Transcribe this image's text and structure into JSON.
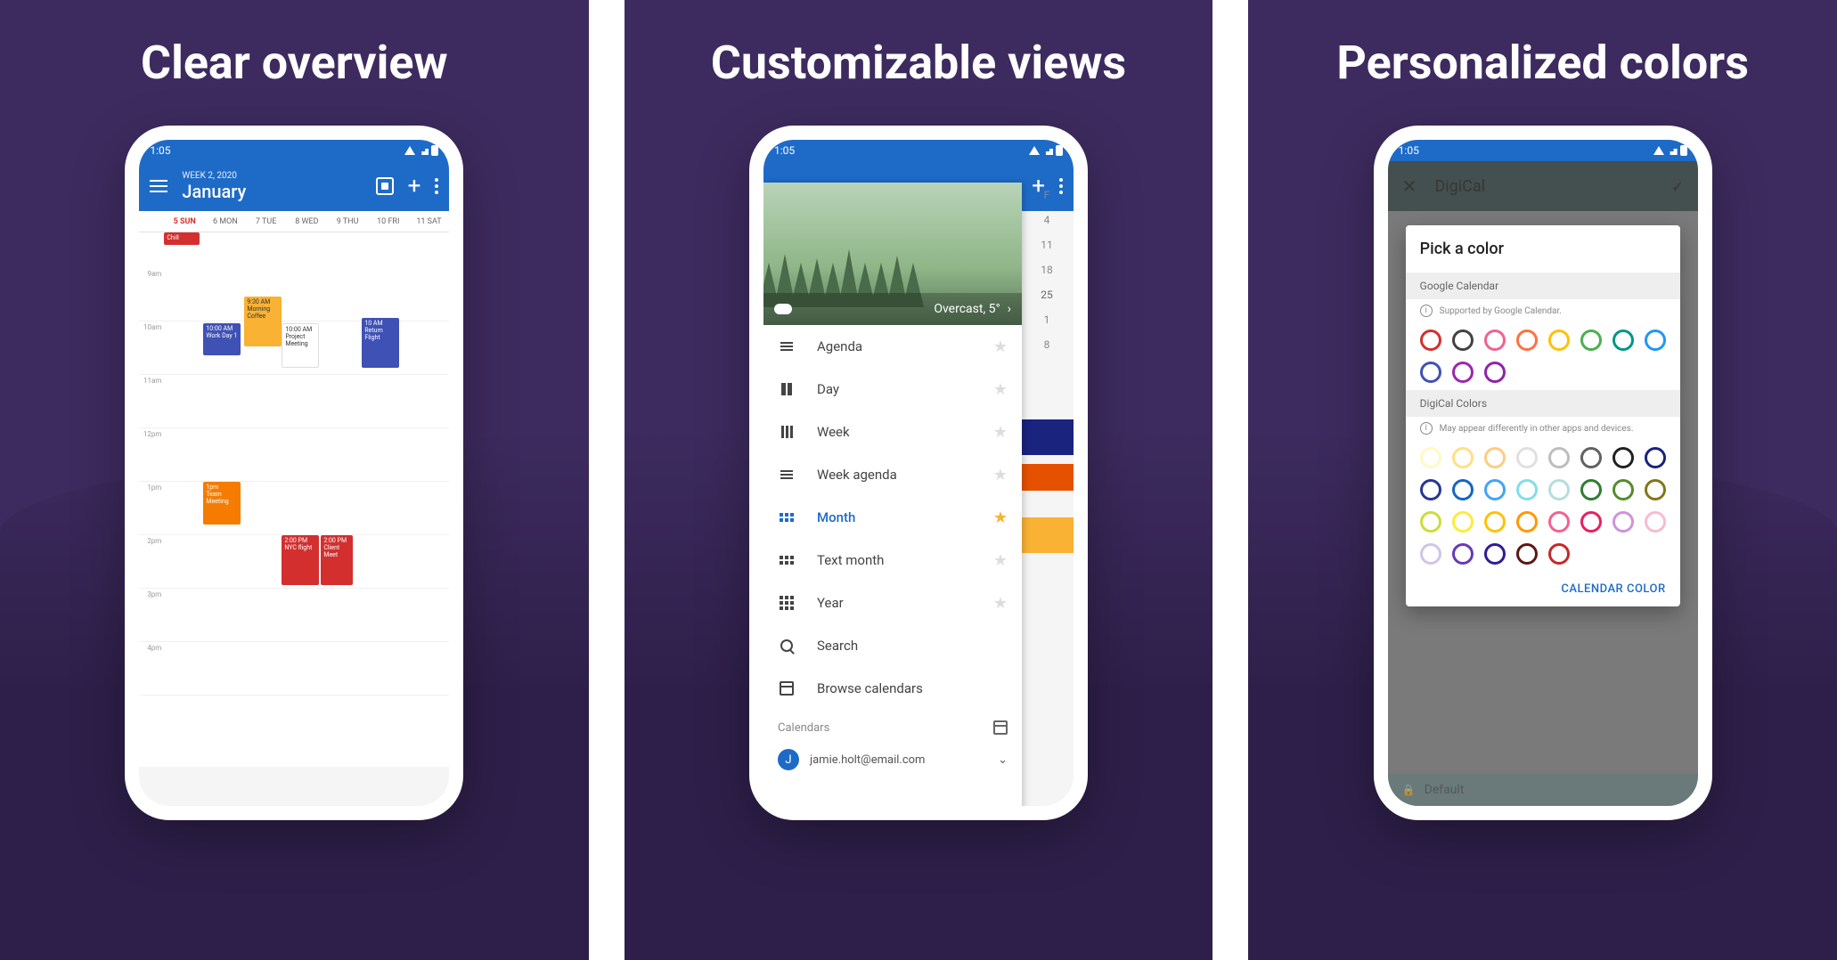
{
  "headlines": [
    "Clear overview",
    "Customizable views",
    "Personalized colors"
  ],
  "status_time": "1:05",
  "phone1": {
    "week_label": "WEEK 2, 2020",
    "month": "January",
    "days": [
      "5 SUN",
      "6 MON",
      "7 TUE",
      "8 WED",
      "9 THU",
      "10 FRI",
      "11 SAT"
    ],
    "hours": [
      "9am",
      "10am",
      "11am",
      "12pm",
      "1pm",
      "2pm",
      "3pm",
      "4pm"
    ],
    "chill": "Chill",
    "events": {
      "morning_coffee": {
        "time": "9:30 AM",
        "title": "Morning Coffee"
      },
      "work_day": {
        "time": "10:00 AM",
        "title": "Work Day 1"
      },
      "project_meeting": {
        "time": "10:00 AM",
        "title": "Project Meeting"
      },
      "return_flight": {
        "time": "10 AM",
        "title": "Return Flight"
      },
      "team_meeting": {
        "time": "1pm",
        "title": "Team Meeting"
      },
      "nyc_flight": {
        "time": "2:00 PM",
        "title": "NYC flight"
      },
      "client_meet": {
        "time": "2:00 PM",
        "title": "Client Meet"
      }
    }
  },
  "phone2": {
    "weather": "Overcast, 5°",
    "month_days": [
      "F",
      "4",
      "11",
      "18",
      "25",
      "",
      "1",
      "8"
    ],
    "drawer_items": [
      {
        "label": "Agenda",
        "active": false
      },
      {
        "label": "Day",
        "active": false
      },
      {
        "label": "Week",
        "active": false
      },
      {
        "label": "Week agenda",
        "active": false
      },
      {
        "label": "Month",
        "active": true
      },
      {
        "label": "Text month",
        "active": false
      },
      {
        "label": "Year",
        "active": false
      },
      {
        "label": "Search",
        "active": false
      },
      {
        "label": "Browse calendars",
        "active": false
      }
    ],
    "calendars_label": "Calendars",
    "account_email": "jamie.holt@email.com",
    "account_initial": "J"
  },
  "phone3": {
    "app_title": "DigiCal",
    "dialog_title": "Pick a color",
    "section1_title": "Google Calendar",
    "section1_note": "Supported by Google Calendar.",
    "section2_title": "DigiCal Colors",
    "section2_note": "May appear differently in other apps and devices.",
    "footer_button": "CALENDAR COLOR",
    "default_label": "Default",
    "google_colors": [
      "#d32f2f",
      "#424242",
      "#f06292",
      "#ff7043",
      "#ffc107",
      "#4caf50",
      "#009688",
      "#2196f3",
      "#3f51b5",
      "#9c27b0",
      "#8e24aa"
    ],
    "digical_colors": [
      "#fff9c4",
      "#ffe082",
      "#ffcc80",
      "#e0e0e0",
      "#bdbdbd",
      "#616161",
      "#212121",
      "#1a237e",
      "#283593",
      "#1565c0",
      "#42a5f5",
      "#80deea",
      "#b2dfdb",
      "#2e7d32",
      "#558b2f",
      "#827717",
      "#cddc39",
      "#ffeb3b",
      "#ffc107",
      "#ff9800",
      "#f06292",
      "#e91e63",
      "#ce93d8",
      "#f8bbd0",
      "#d1c4e9",
      "#673ab7",
      "#311b92",
      "#5d1616",
      "#c62828"
    ]
  }
}
